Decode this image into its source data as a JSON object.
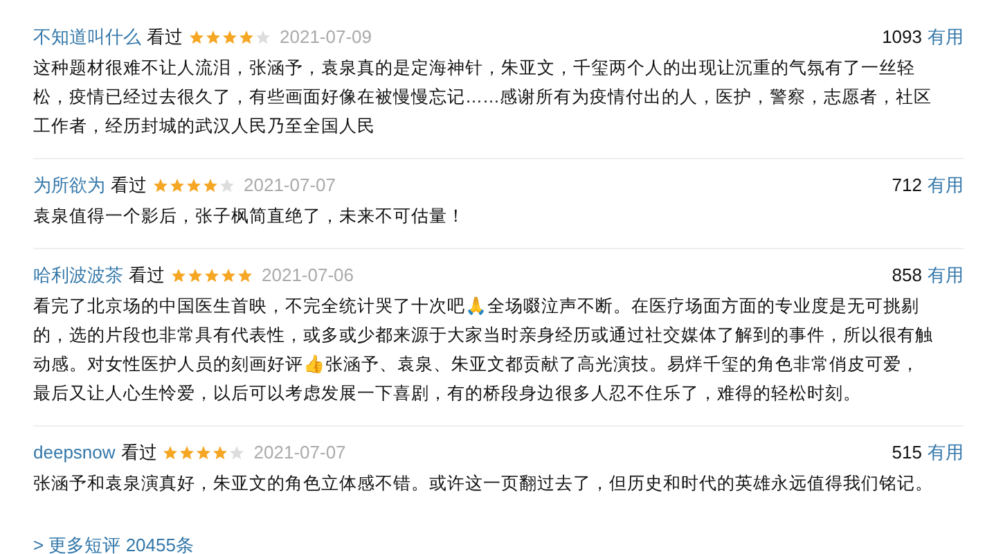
{
  "reviews": [
    {
      "user": "不知道叫什么",
      "status": "看过",
      "stars": 4,
      "date": "2021-07-09",
      "votes": "1093",
      "vote_label": "有用",
      "body": "这种题材很难不让人流泪，张涵予，袁泉真的是定海神针，朱亚文，千玺两个人的出现让沉重的气氛有了一丝轻松，疫情已经过去很久了，有些画面好像在被慢慢忘记……感谢所有为疫情付出的人，医护，警察，志愿者，社区工作者，经历封城的武汉人民乃至全国人民"
    },
    {
      "user": "为所欲为",
      "status": "看过",
      "stars": 4,
      "date": "2021-07-07",
      "votes": "712",
      "vote_label": "有用",
      "body": "袁泉值得一个影后，张子枫简直绝了，未来不可估量！"
    },
    {
      "user": "哈利波波茶",
      "status": "看过",
      "stars": 5,
      "date": "2021-07-06",
      "votes": "858",
      "vote_label": "有用",
      "body": "看完了北京场的中国医生首映，不完全统计哭了十次吧🙏全场啜泣声不断。在医疗场面方面的专业度是无可挑剔的，选的片段也非常具有代表性，或多或少都来源于大家当时亲身经历或通过社交媒体了解到的事件，所以很有触动感。对女性医护人员的刻画好评👍张涵予、袁泉、朱亚文都贡献了高光演技。易烊千玺的角色非常俏皮可爱，最后又让人心生怜爱，以后可以考虑发展一下喜剧，有的桥段身边很多人忍不住乐了，难得的轻松时刻。"
    },
    {
      "user": "deepsnow",
      "status": "看过",
      "stars": 4,
      "date": "2021-07-07",
      "votes": "515",
      "vote_label": "有用",
      "body": "张涵予和袁泉演真好，朱亚文的角色立体感不错。或许这一页翻过去了，但历史和时代的英雄永远值得我们铭记。"
    }
  ],
  "more_link": "> 更多短评 20455条"
}
